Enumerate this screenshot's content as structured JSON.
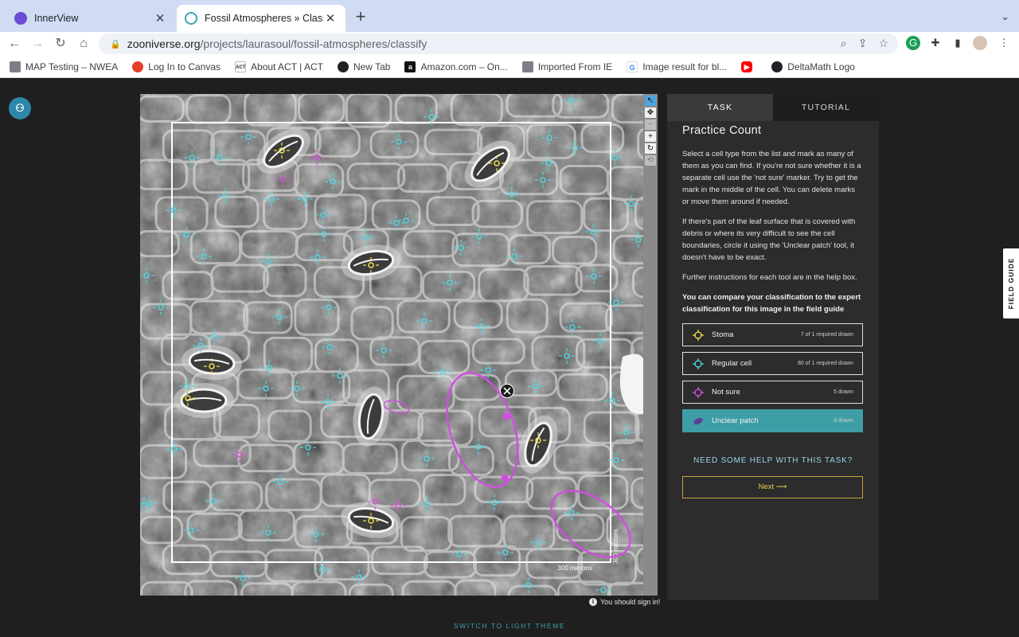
{
  "browser": {
    "tabs": [
      {
        "title": "InnerView",
        "active": false
      },
      {
        "title": "Fossil Atmospheres » Classify",
        "active": true
      }
    ],
    "url_host": "zooniverse.org",
    "url_path": "/projects/laurasoul/fossil-atmospheres/classify",
    "bookmarks": [
      {
        "label": "MAP Testing – NWEA",
        "icon": "folder-icon"
      },
      {
        "label": "Log In to Canvas",
        "icon": "canvas-icon"
      },
      {
        "label": "About ACT | ACT",
        "icon": "act-icon"
      },
      {
        "label": "New Tab",
        "icon": "globe-icon"
      },
      {
        "label": "Amazon.com – On...",
        "icon": "amazon-icon"
      },
      {
        "label": "Imported From IE",
        "icon": "folder-icon"
      },
      {
        "label": "Image result for bl...",
        "icon": "google-icon"
      },
      {
        "label": "",
        "icon": "youtube-icon"
      },
      {
        "label": "DeltaMath Logo",
        "icon": "globe-icon"
      }
    ]
  },
  "viewer": {
    "scale_label_horizontal": "300 microns",
    "scale_label_vertical": "300 microns",
    "sign_in_notice": "You should sign in!"
  },
  "task_panel": {
    "tabs": {
      "task": "TASK",
      "tutorial": "TUTORIAL"
    },
    "title": "Practice Count",
    "paragraphs": [
      "Select a cell type from the list and mark as many of them as you can find. If you're not sure whether it is a separate cell use the 'not sure' marker. Try to get the mark in the middle of the cell. You can delete marks or move them around if needed.",
      "If there's part of the leaf surface that is covered with debris or where its very difficult to see the cell boundaries, circle it using the 'Unclear patch' tool, it doesn't have to be exact.",
      "Further instructions for each tool are in the help box."
    ],
    "bold_paragraph": "You can compare your classification to the expert classification for this image in the field guide",
    "tools": [
      {
        "label": "Stoma",
        "count": "7 of 1 required drawn",
        "color": "#f5e04a",
        "selected": false
      },
      {
        "label": "Regular cell",
        "count": "80 of 1 required drawn",
        "color": "#4fd6e3",
        "selected": false
      },
      {
        "label": "Not sure",
        "count": "5 drawn",
        "color": "#e04ee0",
        "selected": false
      },
      {
        "label": "Unclear patch",
        "count": "3 drawn",
        "color": "#6a3fa0",
        "selected": true
      }
    ],
    "help_link": "NEED SOME HELP WITH THIS TASK?",
    "next_button": "Next ⟶"
  },
  "field_guide_tab": "FIELD GUIDE",
  "theme_switch": "SWITCH TO LIGHT THEME",
  "colors": {
    "stoma": "#f5e04a",
    "regular_cell": "#4fd6e3",
    "not_sure": "#e04ee0",
    "unclear_patch": "#d04fe0",
    "accent_teal": "#3e9ea6",
    "next_gold": "#f0c95a"
  }
}
